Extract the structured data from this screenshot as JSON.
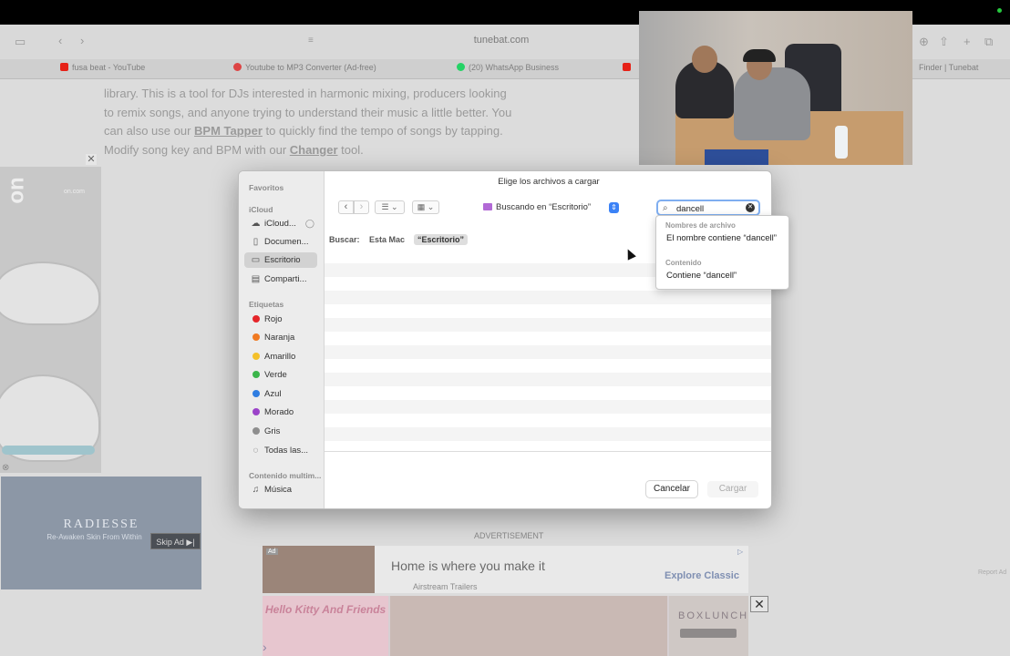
{
  "browser": {
    "url": "tunebat.com",
    "tabs": [
      {
        "label": "fusa beat - YouTube",
        "color": "#e62117"
      },
      {
        "label": "Youtube to MP3 Converter (Ad-free)",
        "color": "#d44"
      },
      {
        "label": "(20) WhatsApp Business",
        "color": "#25d366"
      },
      {
        "label": "Finder | Tunebat",
        "color": "#888"
      }
    ]
  },
  "page": {
    "intro_1": "library. This is a tool for DJs interested in harmonic mixing, producers looking to remix songs, and anyone trying to understand their music a little better. You can also use our",
    "link_bpm": "BPM Tapper",
    "intro_2": "to quickly find the tempo of songs by tapping. Modify song key and BPM with our",
    "link_changer": "Changer",
    "intro_3": "tool."
  },
  "ads": {
    "left_brand": "on.com",
    "radiesse_logo": "RADIESSE",
    "radiesse_tagline": "Re-Awaken Skin From Within",
    "skip_ad": "Skip Ad ▶|",
    "advertisement_label": "ADVERTISEMENT",
    "home_title": "Home is where you make it",
    "home_brand": "Airstream Trailers",
    "home_cta": "Explore Classic",
    "hello_kitty": "Hello Kitty And Friends",
    "boxlunch": "BOXLUNCH",
    "report": "Report Ad",
    "ad_badge": "Ad"
  },
  "dialog": {
    "title": "Elige los archivos a cargar",
    "sidebar": {
      "favorites_head": "Favoritos",
      "icloud_head": "iCloud",
      "icloud_items": [
        "iCloud...",
        "Documen...",
        "Escritorio",
        "Comparti..."
      ],
      "tags_head": "Etiquetas",
      "tags": [
        {
          "label": "Rojo",
          "color": "#e5252a"
        },
        {
          "label": "Naranja",
          "color": "#f07a22"
        },
        {
          "label": "Amarillo",
          "color": "#f4c02a"
        },
        {
          "label": "Verde",
          "color": "#3bb54a"
        },
        {
          "label": "Azul",
          "color": "#2f7de1"
        },
        {
          "label": "Morado",
          "color": "#9b43c9"
        },
        {
          "label": "Gris",
          "color": "#8e8e8e"
        }
      ],
      "all_tags": "Todas las...",
      "media_head": "Contenido multim...",
      "media_items": [
        "Música"
      ]
    },
    "location": "Buscando en “Escritorio”",
    "search_value": "dancell",
    "scope_label": "Buscar:",
    "scope_mac": "Esta Mac",
    "scope_desktop": "“Escritorio”",
    "cancel": "Cancelar",
    "load": "Cargar"
  },
  "suggestions": {
    "filenames_head": "Nombres de archivo",
    "filenames_item": "El nombre contiene “dancell”",
    "content_head": "Contenido",
    "content_item": "Contiene “dancell”"
  }
}
